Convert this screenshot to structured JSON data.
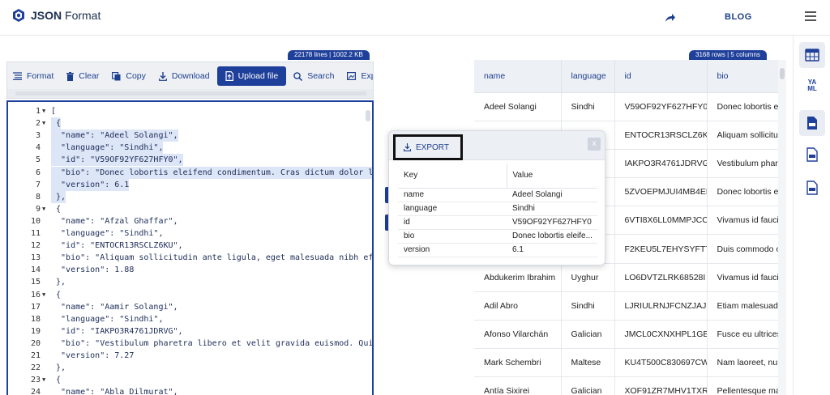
{
  "header": {
    "logo_bold": "JSON",
    "logo_rest": " Format",
    "blog_label": "BLOG"
  },
  "editor": {
    "badge": "22178 lines | 1002.2 KB",
    "toolbar": [
      {
        "label": "Format",
        "icon": "format-icon"
      },
      {
        "label": "Clear",
        "icon": "trash-icon"
      },
      {
        "label": "Copy",
        "icon": "copy-icon"
      },
      {
        "label": "Download",
        "icon": "download-icon"
      },
      {
        "label": "Upload file",
        "icon": "upload-icon"
      },
      {
        "label": "Search",
        "icon": "search-icon"
      },
      {
        "label": "Expan",
        "icon": "expand-icon"
      }
    ],
    "lines": [
      {
        "n": "1",
        "fold": "▼",
        "text": "[",
        "hl": false
      },
      {
        "n": "2",
        "fold": "▼",
        "text": " {",
        "hl": true
      },
      {
        "n": "3",
        "fold": "",
        "text": "  \"name\": \"Adeel Solangi\",",
        "hl": true
      },
      {
        "n": "4",
        "fold": "",
        "text": "  \"language\": \"Sindhi\",",
        "hl": true
      },
      {
        "n": "5",
        "fold": "",
        "text": "  \"id\": \"V59OF92YF627HFY0\",",
        "hl": true
      },
      {
        "n": "6",
        "fold": "",
        "text": "  \"bio\": \"Donec lobortis eleifend condimentum. Cras dictum dolor l",
        "hl": true
      },
      {
        "n": "7",
        "fold": "",
        "text": "  \"version\": 6.1",
        "hl": true
      },
      {
        "n": "8",
        "fold": "",
        "text": " },",
        "hl": true
      },
      {
        "n": "9",
        "fold": "▼",
        "text": " {",
        "hl": false
      },
      {
        "n": "10",
        "fold": "",
        "text": "  \"name\": \"Afzal Ghaffar\",",
        "hl": false
      },
      {
        "n": "11",
        "fold": "",
        "text": "  \"language\": \"Sindhi\",",
        "hl": false
      },
      {
        "n": "12",
        "fold": "",
        "text": "  \"id\": \"ENTOCR13RSCLZ6KU\",",
        "hl": false
      },
      {
        "n": "13",
        "fold": "",
        "text": "  \"bio\": \"Aliquam sollicitudin ante ligula, eget malesuada nibh ef",
        "hl": false
      },
      {
        "n": "14",
        "fold": "",
        "text": "  \"version\": 1.88",
        "hl": false
      },
      {
        "n": "15",
        "fold": "",
        "text": " },",
        "hl": false
      },
      {
        "n": "16",
        "fold": "▼",
        "text": " {",
        "hl": false
      },
      {
        "n": "17",
        "fold": "",
        "text": "  \"name\": \"Aamir Solangi\",",
        "hl": false
      },
      {
        "n": "18",
        "fold": "",
        "text": "  \"language\": \"Sindhi\",",
        "hl": false
      },
      {
        "n": "19",
        "fold": "",
        "text": "  \"id\": \"IAKPO3R4761JDRVG\",",
        "hl": false
      },
      {
        "n": "20",
        "fold": "",
        "text": "  \"bio\": \"Vestibulum pharetra libero et velit gravida euismod. Qui",
        "hl": false
      },
      {
        "n": "21",
        "fold": "",
        "text": "  \"version\": 7.27",
        "hl": false
      },
      {
        "n": "22",
        "fold": "",
        "text": " },",
        "hl": false
      },
      {
        "n": "23",
        "fold": "▼",
        "text": " {",
        "hl": false
      },
      {
        "n": "24",
        "fold": "",
        "text": "  \"name\": \"Abla Dilmurat\",",
        "hl": false
      }
    ]
  },
  "table": {
    "badge": "3168 rows | 5 columns",
    "columns": [
      "name",
      "language",
      "id",
      "bio"
    ],
    "rows": [
      [
        "Adeel Solangi",
        "Sindhi",
        "V59OF92YF627HFY0",
        "Donec lobortis ele"
      ],
      [
        "",
        "",
        "ENTOCR13RSCLZ6KU",
        "Aliquam sollicitud"
      ],
      [
        "",
        "",
        "IAKPO3R4761JDRVG",
        "Vestibulum phare"
      ],
      [
        "",
        "",
        "5ZVOEPMJUI4MB4EN",
        "Donec lobortis ele"
      ],
      [
        "",
        "",
        "6VTI8X6LL0MMPJCC",
        "Vivamus id faucib"
      ],
      [
        "",
        "",
        "F2KEU5L7EHYSYFTT",
        "Duis commodo o"
      ],
      [
        "Abdukerim Ibrahim",
        "Uyghur",
        "LO6DVTZLRK68528I",
        "Vivamus id faucib"
      ],
      [
        "Adil Abro",
        "Sindhi",
        "LJRIULRNJFCNZJAJ",
        "Etiam malesuada"
      ],
      [
        "Afonso Vilarchán",
        "Galician",
        "JMCL0CXNXHPL1GBC",
        "Fusce eu ultrices"
      ],
      [
        "Mark Schembri",
        "Maltese",
        "KU4T500C830697CW",
        "Nam laoreet, nur"
      ],
      [
        "Antía Sixirei",
        "Galician",
        "XOF91ZR7MHV1TXRS",
        "Pellentesque mas"
      ]
    ]
  },
  "popup": {
    "export_label": "EXPORT",
    "close_label": "x",
    "key_header": "Key",
    "value_header": "Value",
    "rows": [
      {
        "key": "name",
        "value": "Adeel Solangi"
      },
      {
        "key": "language",
        "value": "Sindhi"
      },
      {
        "key": "id",
        "value": "V59OF92YF627HFY0"
      },
      {
        "key": "bio",
        "value": "Donec lobortis eleife..."
      },
      {
        "key": "version",
        "value": "6.1"
      }
    ]
  },
  "sidebar": {
    "yaml_top": "YA",
    "yaml_bottom": "ML"
  },
  "colors": {
    "accent": "#1e3f9a",
    "highlight": "#dde6f7",
    "toolbar_bg": "#eef0f4"
  }
}
